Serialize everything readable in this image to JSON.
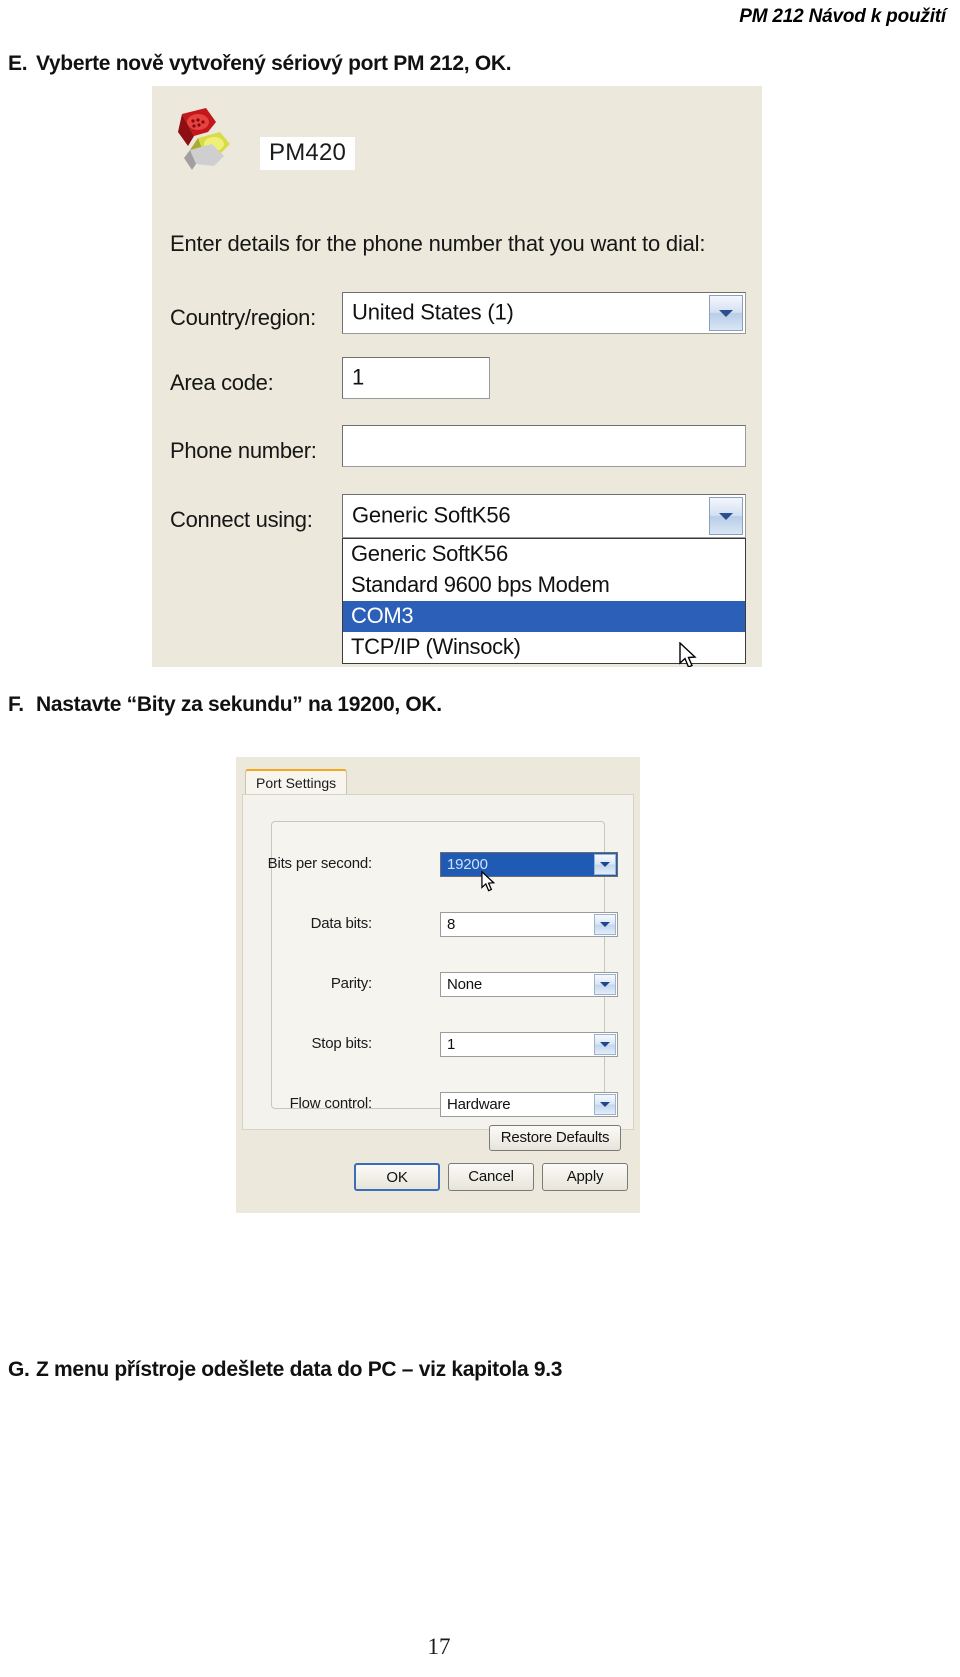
{
  "header": {
    "running_head": "PM 212 Návod k použití"
  },
  "steps": [
    {
      "marker": "E.",
      "text": "Vyberte nově vytvořený sériový port PM 212, OK."
    },
    {
      "marker": "F.",
      "text": "Nastavte “Bity za sekundu” na 19200, OK."
    },
    {
      "marker": "G.",
      "text": "Z menu přístroje odešlete data do PC – viz kapitola 9.3"
    }
  ],
  "footer": {
    "page_number": "17"
  },
  "figure_dialup": {
    "icon": "phone-icon",
    "title": "PM420",
    "instruction": "Enter details for the phone number that you want to dial:",
    "fields": [
      {
        "label": "Country/region:",
        "value": "United States (1)",
        "type": "combo"
      },
      {
        "label": "Area code:",
        "value": "1",
        "type": "text"
      },
      {
        "label": "Phone number:",
        "value": "",
        "type": "text"
      },
      {
        "label": "Connect using:",
        "value": "Generic SoftK56",
        "type": "combo"
      }
    ],
    "dropdown_options": [
      {
        "label": "Generic SoftK56",
        "selected": false
      },
      {
        "label": "Standard  9600 bps Modem",
        "selected": false
      },
      {
        "label": "COM3",
        "selected": true
      },
      {
        "label": "TCP/IP (Winsock)",
        "selected": false
      }
    ],
    "colors": {
      "dialog_bg": "#ece8dc",
      "selection_blue": "#2b5fb8"
    }
  },
  "figure_port_settings": {
    "tab": "Port Settings",
    "rows": [
      {
        "label": "Bits per second:",
        "value": "19200",
        "highlighted": true
      },
      {
        "label": "Data bits:",
        "value": "8",
        "highlighted": false
      },
      {
        "label": "Parity:",
        "value": "None",
        "highlighted": false
      },
      {
        "label": "Stop bits:",
        "value": "1",
        "highlighted": false
      },
      {
        "label": "Flow control:",
        "value": "Hardware",
        "highlighted": false
      }
    ],
    "restore_button": "Restore Defaults",
    "buttons": [
      {
        "label": "OK",
        "default": true
      },
      {
        "label": "Cancel",
        "default": false
      },
      {
        "label": "Apply",
        "default": false
      }
    ],
    "colors": {
      "dialog_bg": "#ece8dc",
      "tab_accent": "#f0a81e",
      "selection_blue": "#1f5bb5"
    }
  }
}
